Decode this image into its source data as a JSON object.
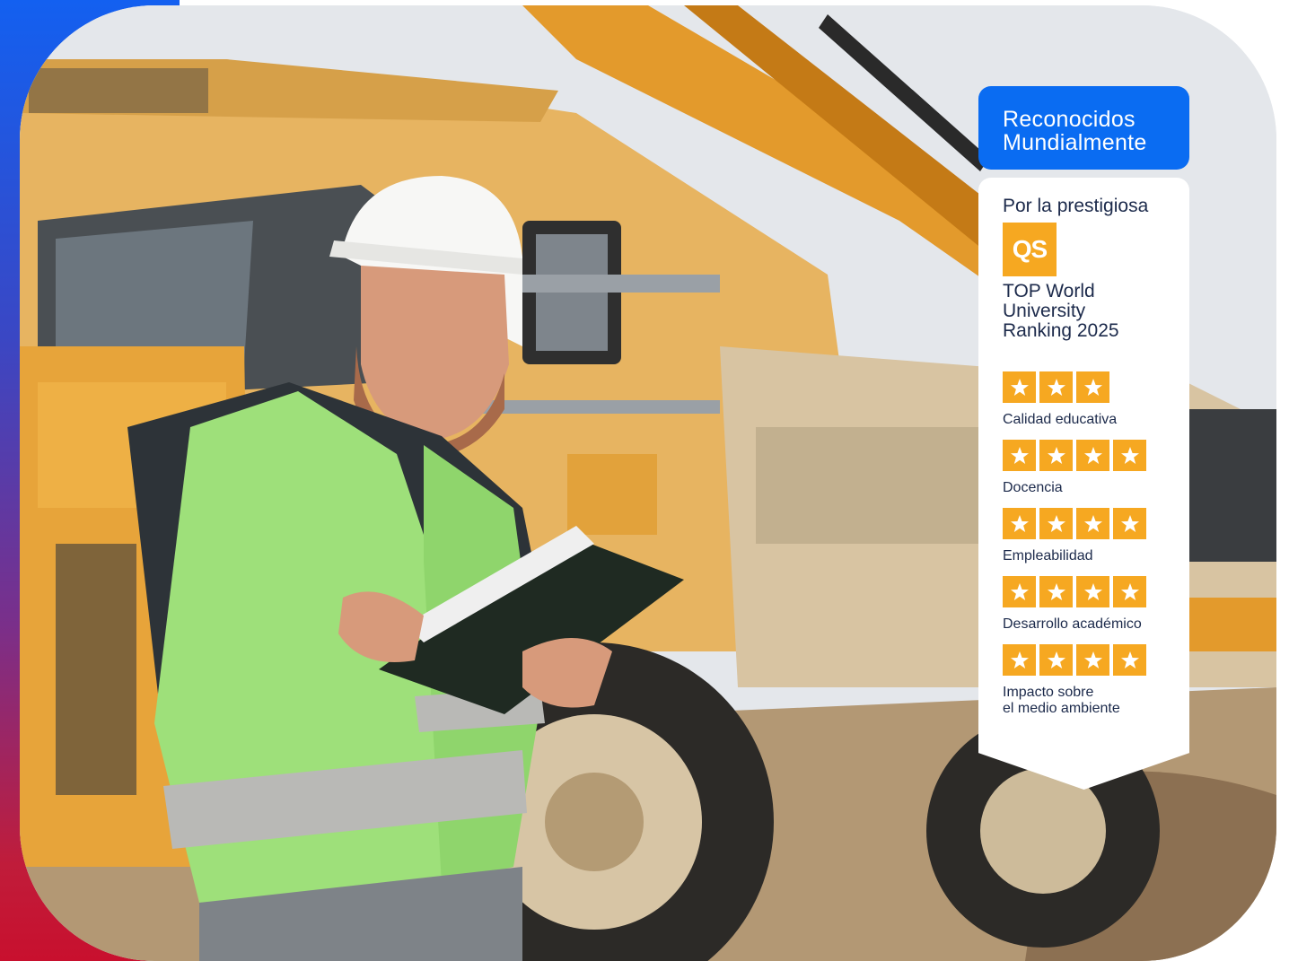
{
  "badge": {
    "title_lines": [
      "Reconocidos",
      "Mundialmente"
    ],
    "intro": "Por la prestigiosa",
    "logo_text": "QS",
    "ranking_lines": [
      "TOP World",
      "University",
      "Ranking 2025"
    ],
    "criteria": [
      {
        "label_lines": [
          "Calidad educativa"
        ],
        "stars": 3
      },
      {
        "label_lines": [
          "Docencia"
        ],
        "stars": 4
      },
      {
        "label_lines": [
          "Empleabilidad"
        ],
        "stars": 4
      },
      {
        "label_lines": [
          "Desarrollo académico"
        ],
        "stars": 4
      },
      {
        "label_lines": [
          "Impacto sobre",
          "el medio ambiente"
        ],
        "stars": 4
      }
    ]
  },
  "colors": {
    "badge_blue": "#0a6cf2",
    "star_gold": "#f6a821",
    "text_navy": "#1c2a4b",
    "frame_gradient_top": "#1360f0",
    "frame_gradient_bottom": "#c8102e"
  },
  "icons": {
    "star": "star-icon",
    "logo": "qs-logo-icon"
  }
}
